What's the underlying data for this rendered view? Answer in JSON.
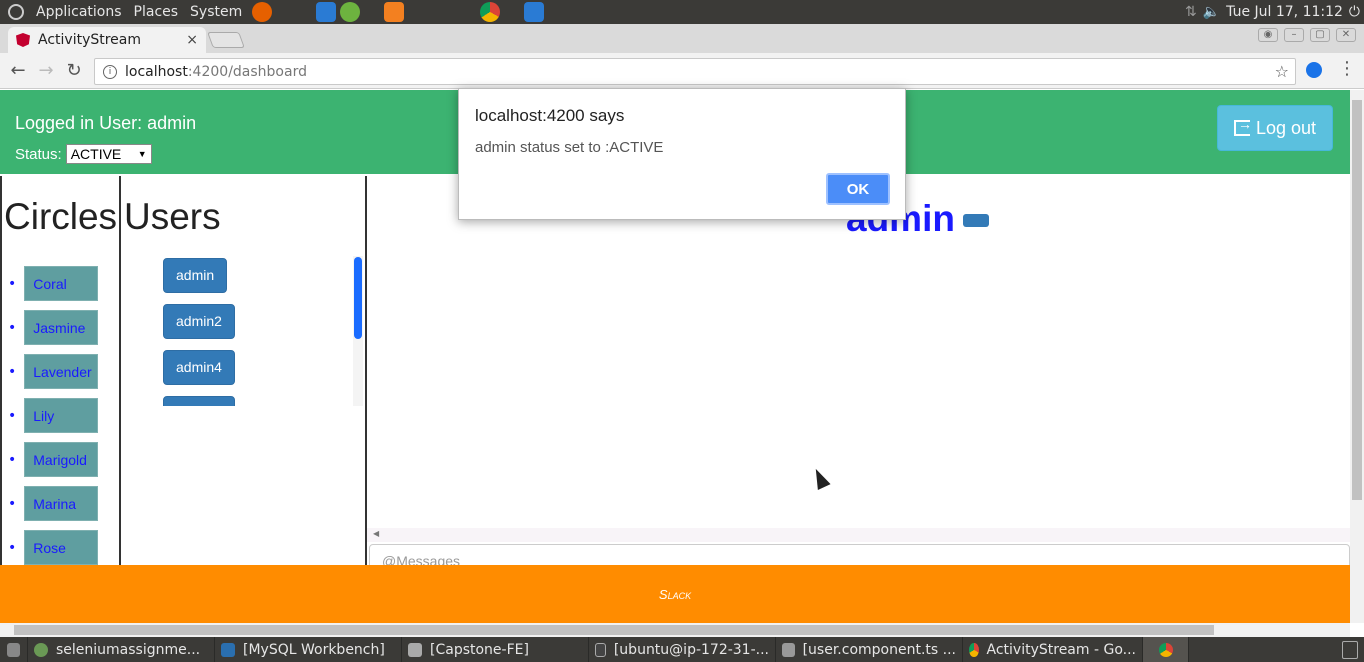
{
  "system_panel": {
    "menus": [
      "Applications",
      "Places",
      "System"
    ],
    "clock": "Tue Jul 17, 11:12"
  },
  "browser": {
    "tab_title": "ActivityStream",
    "tab_close": "×",
    "url_host": "localhost",
    "url_path": ":4200/dashboard",
    "back": "←",
    "forward": "→",
    "reload": "↻",
    "star": "☆",
    "menu": "⋮"
  },
  "header": {
    "logged_in_text": "Logged in User: admin",
    "status_label": "Status:",
    "status_value": "ACTIVE",
    "logout_label": "Log out"
  },
  "circles": {
    "title": "Circles",
    "items": [
      "Coral",
      "Jasmine",
      "Lavender",
      "Lily",
      "Marigold",
      "Marina",
      "Rose"
    ]
  },
  "users": {
    "title": "Users",
    "items": [
      "admin",
      "admin2",
      "admin4",
      ""
    ]
  },
  "chat": {
    "title": "admin",
    "message_placeholder": "@Messages"
  },
  "footer": {
    "text": "Slack"
  },
  "dialog": {
    "title": "localhost:4200 says",
    "message": "admin status set to :ACTIVE",
    "ok_label": "OK"
  },
  "taskbar": {
    "items": [
      "seleniumassignme...",
      "[MySQL Workbench]",
      "[Capstone-FE]",
      "[ubuntu@ip-172-31-...",
      "[user.component.ts ...",
      "ActivityStream - Go..."
    ]
  },
  "colors": {
    "header_bg": "#3cb371",
    "footer_bg": "#ff8c00",
    "user_btn": "#337ab7",
    "circle_btn": "#5f9ea0",
    "logout_btn": "#5bc0de",
    "dialog_ok": "#4b8df8"
  }
}
